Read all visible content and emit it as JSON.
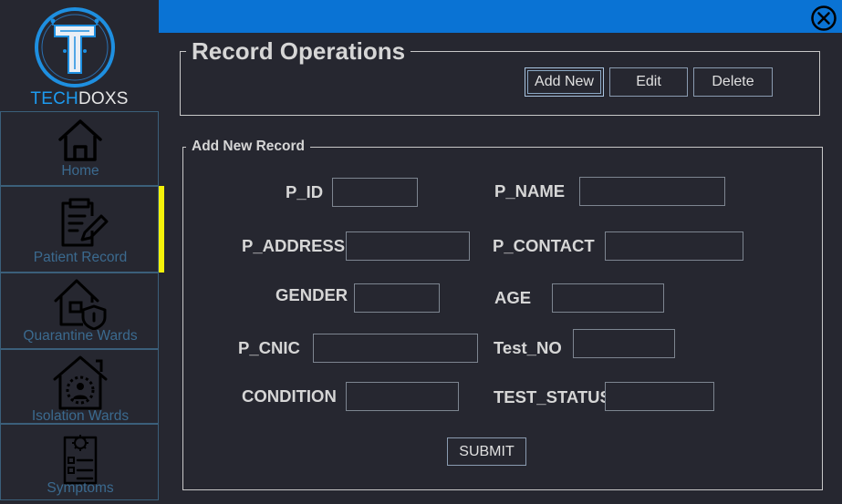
{
  "app": {
    "brand_part1": "TECH",
    "brand_part2": "DOXS"
  },
  "sidebar": {
    "items": [
      {
        "label": "Home",
        "icon": "home-icon"
      },
      {
        "label": "Patient Record",
        "icon": "clipboard-edit-icon",
        "active": true
      },
      {
        "label": "Quarantine Wards",
        "icon": "house-shield-icon"
      },
      {
        "label": "Isolation Wards",
        "icon": "house-person-icon"
      },
      {
        "label": "Symptoms",
        "icon": "checklist-virus-icon"
      }
    ],
    "active_indicator_color": "#f5f20a"
  },
  "topbar": {
    "color": "#0a73d4",
    "close_icon": "close-circle-icon"
  },
  "record_operations": {
    "title": "Record Operations",
    "buttons": {
      "add_new": "Add New",
      "edit": "Edit",
      "delete": "Delete"
    }
  },
  "add_new_record": {
    "title": "Add New Record",
    "fields": {
      "p_id": {
        "label": "P_ID",
        "value": ""
      },
      "p_name": {
        "label": "P_NAME",
        "value": ""
      },
      "p_address": {
        "label": "P_ADDRESS",
        "value": ""
      },
      "p_contact": {
        "label": "P_CONTACT",
        "value": ""
      },
      "gender": {
        "label": "GENDER",
        "value": ""
      },
      "age": {
        "label": "AGE",
        "value": ""
      },
      "p_cnic": {
        "label": "P_CNIC",
        "value": ""
      },
      "test_no": {
        "label": "Test_NO",
        "value": ""
      },
      "condition": {
        "label": "CONDITION",
        "value": ""
      },
      "test_status": {
        "label": "TEST_STATUS",
        "value": ""
      }
    },
    "submit_label": "SUBMIT"
  }
}
